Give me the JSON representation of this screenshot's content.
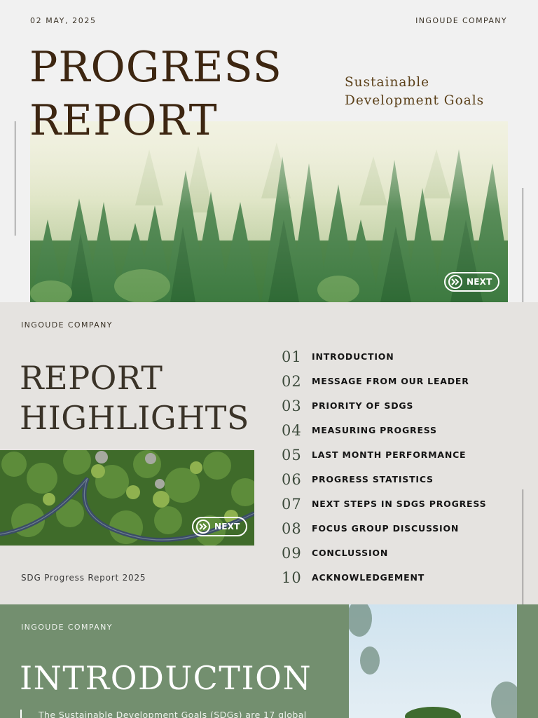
{
  "cover": {
    "date": "02 MAY, 2025",
    "company": "INGOUDE COMPANY",
    "title_line1": "PROGRESS",
    "title_line2": "REPORT",
    "subtitle_line1": "Sustainable",
    "subtitle_line2": "Development Goals",
    "next_label": "NEXT"
  },
  "highlights": {
    "company": "INGOUDE COMPANY",
    "title_line1": "REPORT",
    "title_line2": "HIGHLIGHTS",
    "next_label": "NEXT",
    "footer": "SDG Progress Report 2025",
    "toc": [
      {
        "num": "01",
        "label": "INTRODUCTION"
      },
      {
        "num": "02",
        "label": "MESSAGE FROM OUR LEADER"
      },
      {
        "num": "03",
        "label": "PRIORITY OF SDGS"
      },
      {
        "num": "04",
        "label": "MEASURING PROGRESS"
      },
      {
        "num": "05",
        "label": "LAST MONTH PERFORMANCE"
      },
      {
        "num": "06",
        "label": "PROGRESS STATISTICS"
      },
      {
        "num": "07",
        "label": "NEXT STEPS IN SDGS PROGRESS"
      },
      {
        "num": "08",
        "label": "FOCUS GROUP DISCUSSION"
      },
      {
        "num": "09",
        "label": "CONCLUSSION"
      },
      {
        "num": "10",
        "label": "ACKNOWLEDGEMENT"
      }
    ]
  },
  "intro": {
    "company": "INGOUDE COMPANY",
    "title": "INTRODUCTION",
    "body": "The Sustainable Development Goals (SDGs) are 17 global"
  },
  "colors": {
    "cover_bg": "#f1f1f1",
    "title_brown": "#3d2611",
    "highlights_bg": "#e5e3e0",
    "intro_green": "#738f6f"
  },
  "icons": {
    "next": "double-chevron-right-icon"
  }
}
